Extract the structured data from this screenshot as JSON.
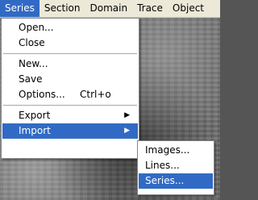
{
  "menubar": {
    "items": [
      {
        "label": "Series"
      },
      {
        "label": "Section"
      },
      {
        "label": "Domain"
      },
      {
        "label": "Trace"
      },
      {
        "label": "Object"
      }
    ]
  },
  "series_menu": {
    "open": "Open...",
    "close": "Close",
    "new": "New...",
    "save": "Save",
    "options": "Options...",
    "options_shortcut": "Ctrl+o",
    "export": "Export",
    "import": "Import",
    "submenu_arrow": "▶"
  },
  "import_submenu": {
    "images": "Images...",
    "lines": "Lines...",
    "series": "Series..."
  },
  "colors": {
    "highlight": "#316ac5",
    "menubar": "#ece9d8"
  }
}
